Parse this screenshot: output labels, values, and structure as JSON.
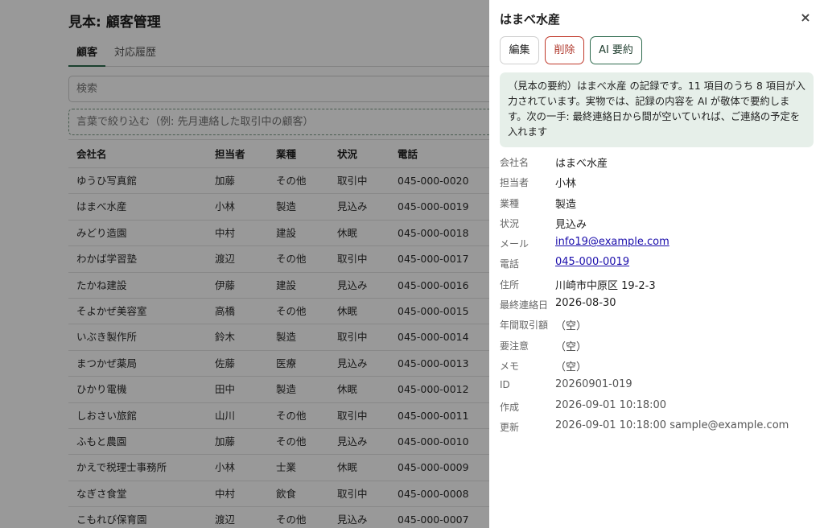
{
  "page": {
    "title": "見本: 顧客管理",
    "tabs": [
      {
        "label": "顧客",
        "active": true
      },
      {
        "label": "対応履歴",
        "active": false
      }
    ],
    "search_placeholder": "検索",
    "nl_filter_placeholder": "言葉で絞り込む（例: 先月連絡した取引中の顧客）"
  },
  "table": {
    "columns": [
      "会社名",
      "担当者",
      "業種",
      "状況",
      "電話"
    ],
    "rows": [
      [
        "ゆうひ写真館",
        "加藤",
        "その他",
        "取引中",
        "045-000-0020"
      ],
      [
        "はまべ水産",
        "小林",
        "製造",
        "見込み",
        "045-000-0019"
      ],
      [
        "みどり造園",
        "中村",
        "建設",
        "休眠",
        "045-000-0018"
      ],
      [
        "わかば学習塾",
        "渡辺",
        "その他",
        "取引中",
        "045-000-0017"
      ],
      [
        "たかね建設",
        "伊藤",
        "建設",
        "見込み",
        "045-000-0016"
      ],
      [
        "そよかぜ美容室",
        "高橋",
        "その他",
        "休眠",
        "045-000-0015"
      ],
      [
        "いぶき製作所",
        "鈴木",
        "製造",
        "取引中",
        "045-000-0014"
      ],
      [
        "まつかぜ薬局",
        "佐藤",
        "医療",
        "見込み",
        "045-000-0013"
      ],
      [
        "ひかり電機",
        "田中",
        "製造",
        "休眠",
        "045-000-0012"
      ],
      [
        "しおさい旅館",
        "山川",
        "その他",
        "取引中",
        "045-000-0011"
      ],
      [
        "ふもと農園",
        "加藤",
        "その他",
        "見込み",
        "045-000-0010"
      ],
      [
        "かえで税理士事務所",
        "小林",
        "士業",
        "休眠",
        "045-000-0009"
      ],
      [
        "なぎさ食堂",
        "中村",
        "飲食",
        "取引中",
        "045-000-0008"
      ],
      [
        "こもれび保育園",
        "渡辺",
        "その他",
        "見込み",
        "045-000-0007"
      ]
    ]
  },
  "drawer": {
    "title": "はまべ水産",
    "close_glyph": "×",
    "buttons": {
      "edit": "編集",
      "delete": "削除",
      "ai_summary": "AI 要約"
    },
    "summary_text": "（見本の要約）はまべ水産 の記録です。11 項目のうち 8 項目が入力されています。実物では、記録の内容を AI が敬体で要約します。次の一手: 最終連絡日から間が空いていれば、ご連絡の予定を入れます",
    "fields": [
      {
        "label": "会社名",
        "value": "はまべ水産",
        "style": "normal"
      },
      {
        "label": "担当者",
        "value": "小林",
        "style": "normal"
      },
      {
        "label": "業種",
        "value": "製造",
        "style": "normal"
      },
      {
        "label": "状況",
        "value": "見込み",
        "style": "normal"
      },
      {
        "label": "メール",
        "value": "info19@example.com",
        "style": "link"
      },
      {
        "label": "電話",
        "value": "045-000-0019",
        "style": "link"
      },
      {
        "label": "住所",
        "value": "川崎市中原区 19-2-3",
        "style": "normal"
      },
      {
        "label": "最終連絡日",
        "value": "2026-08-30",
        "style": "normal"
      },
      {
        "label": "年間取引額",
        "value": "（空）",
        "style": "muted"
      },
      {
        "label": "要注意",
        "value": "（空）",
        "style": "muted"
      },
      {
        "label": "メモ",
        "value": "（空）",
        "style": "muted"
      },
      {
        "label": "ID",
        "value": "20260901-019",
        "style": "meta"
      },
      {
        "label": "作成",
        "value": "2026-09-01 10:18:00",
        "style": "meta"
      },
      {
        "label": "更新",
        "value": "2026-09-01 10:18:00 sample@example.com",
        "style": "meta"
      }
    ]
  }
}
